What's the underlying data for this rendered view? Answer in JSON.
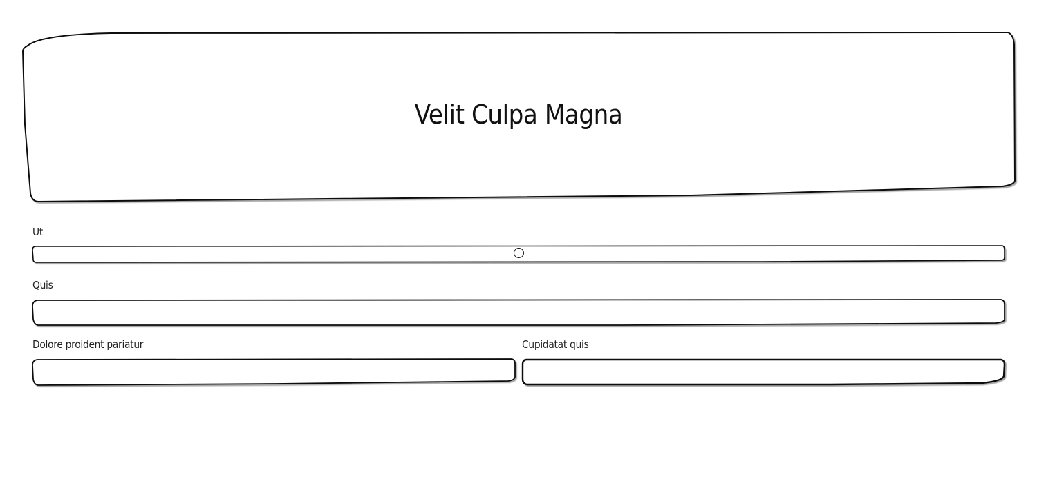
{
  "header": {
    "title": "Velit Culpa Magna"
  },
  "form": {
    "slider": {
      "label": "Ut",
      "value_fraction": 0.5
    },
    "quis": {
      "label": "Quis",
      "value": ""
    },
    "dolore": {
      "label": "Dolore proident pariatur",
      "value": ""
    },
    "cupidatat": {
      "label": "Cupidatat quis",
      "value": ""
    }
  }
}
